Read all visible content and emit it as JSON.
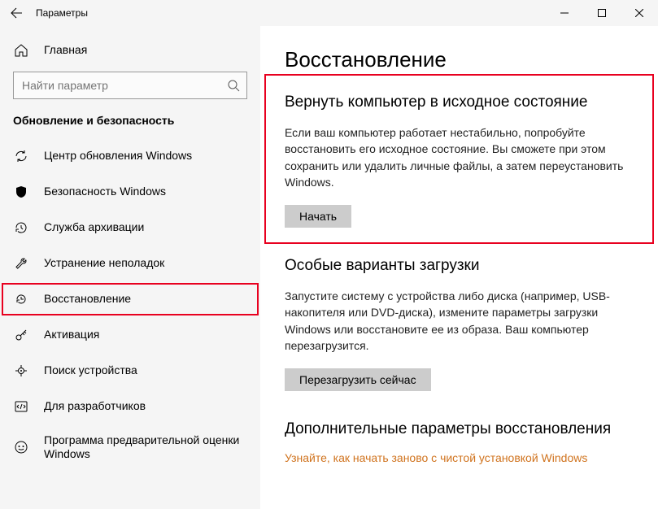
{
  "titlebar": {
    "title": "Параметры"
  },
  "sidebar": {
    "home": "Главная",
    "search_placeholder": "Найти параметр",
    "section": "Обновление и безопасность",
    "items": [
      {
        "label": "Центр обновления Windows"
      },
      {
        "label": "Безопасность Windows"
      },
      {
        "label": "Служба архивации"
      },
      {
        "label": "Устранение неполадок"
      },
      {
        "label": "Восстановление"
      },
      {
        "label": "Активация"
      },
      {
        "label": "Поиск устройства"
      },
      {
        "label": "Для разработчиков"
      },
      {
        "label": "Программа предварительной оценки Windows"
      }
    ]
  },
  "content": {
    "title": "Восстановление",
    "reset": {
      "heading": "Вернуть компьютер в исходное состояние",
      "body": "Если ваш компьютер работает нестабильно, попробуйте восстановить его исходное состояние. Вы сможете при этом сохранить или удалить личные файлы, а затем переустановить Windows.",
      "button": "Начать"
    },
    "advanced": {
      "heading": "Особые варианты загрузки",
      "body": "Запустите систему с устройства либо диска (например, USB-накопителя или DVD-диска), измените параметры загрузки Windows или восстановите ее из образа. Ваш компьютер перезагрузится.",
      "button": "Перезагрузить сейчас"
    },
    "more": {
      "heading": "Дополнительные параметры восстановления",
      "link": "Узнайте, как начать заново с чистой установкой Windows"
    }
  }
}
